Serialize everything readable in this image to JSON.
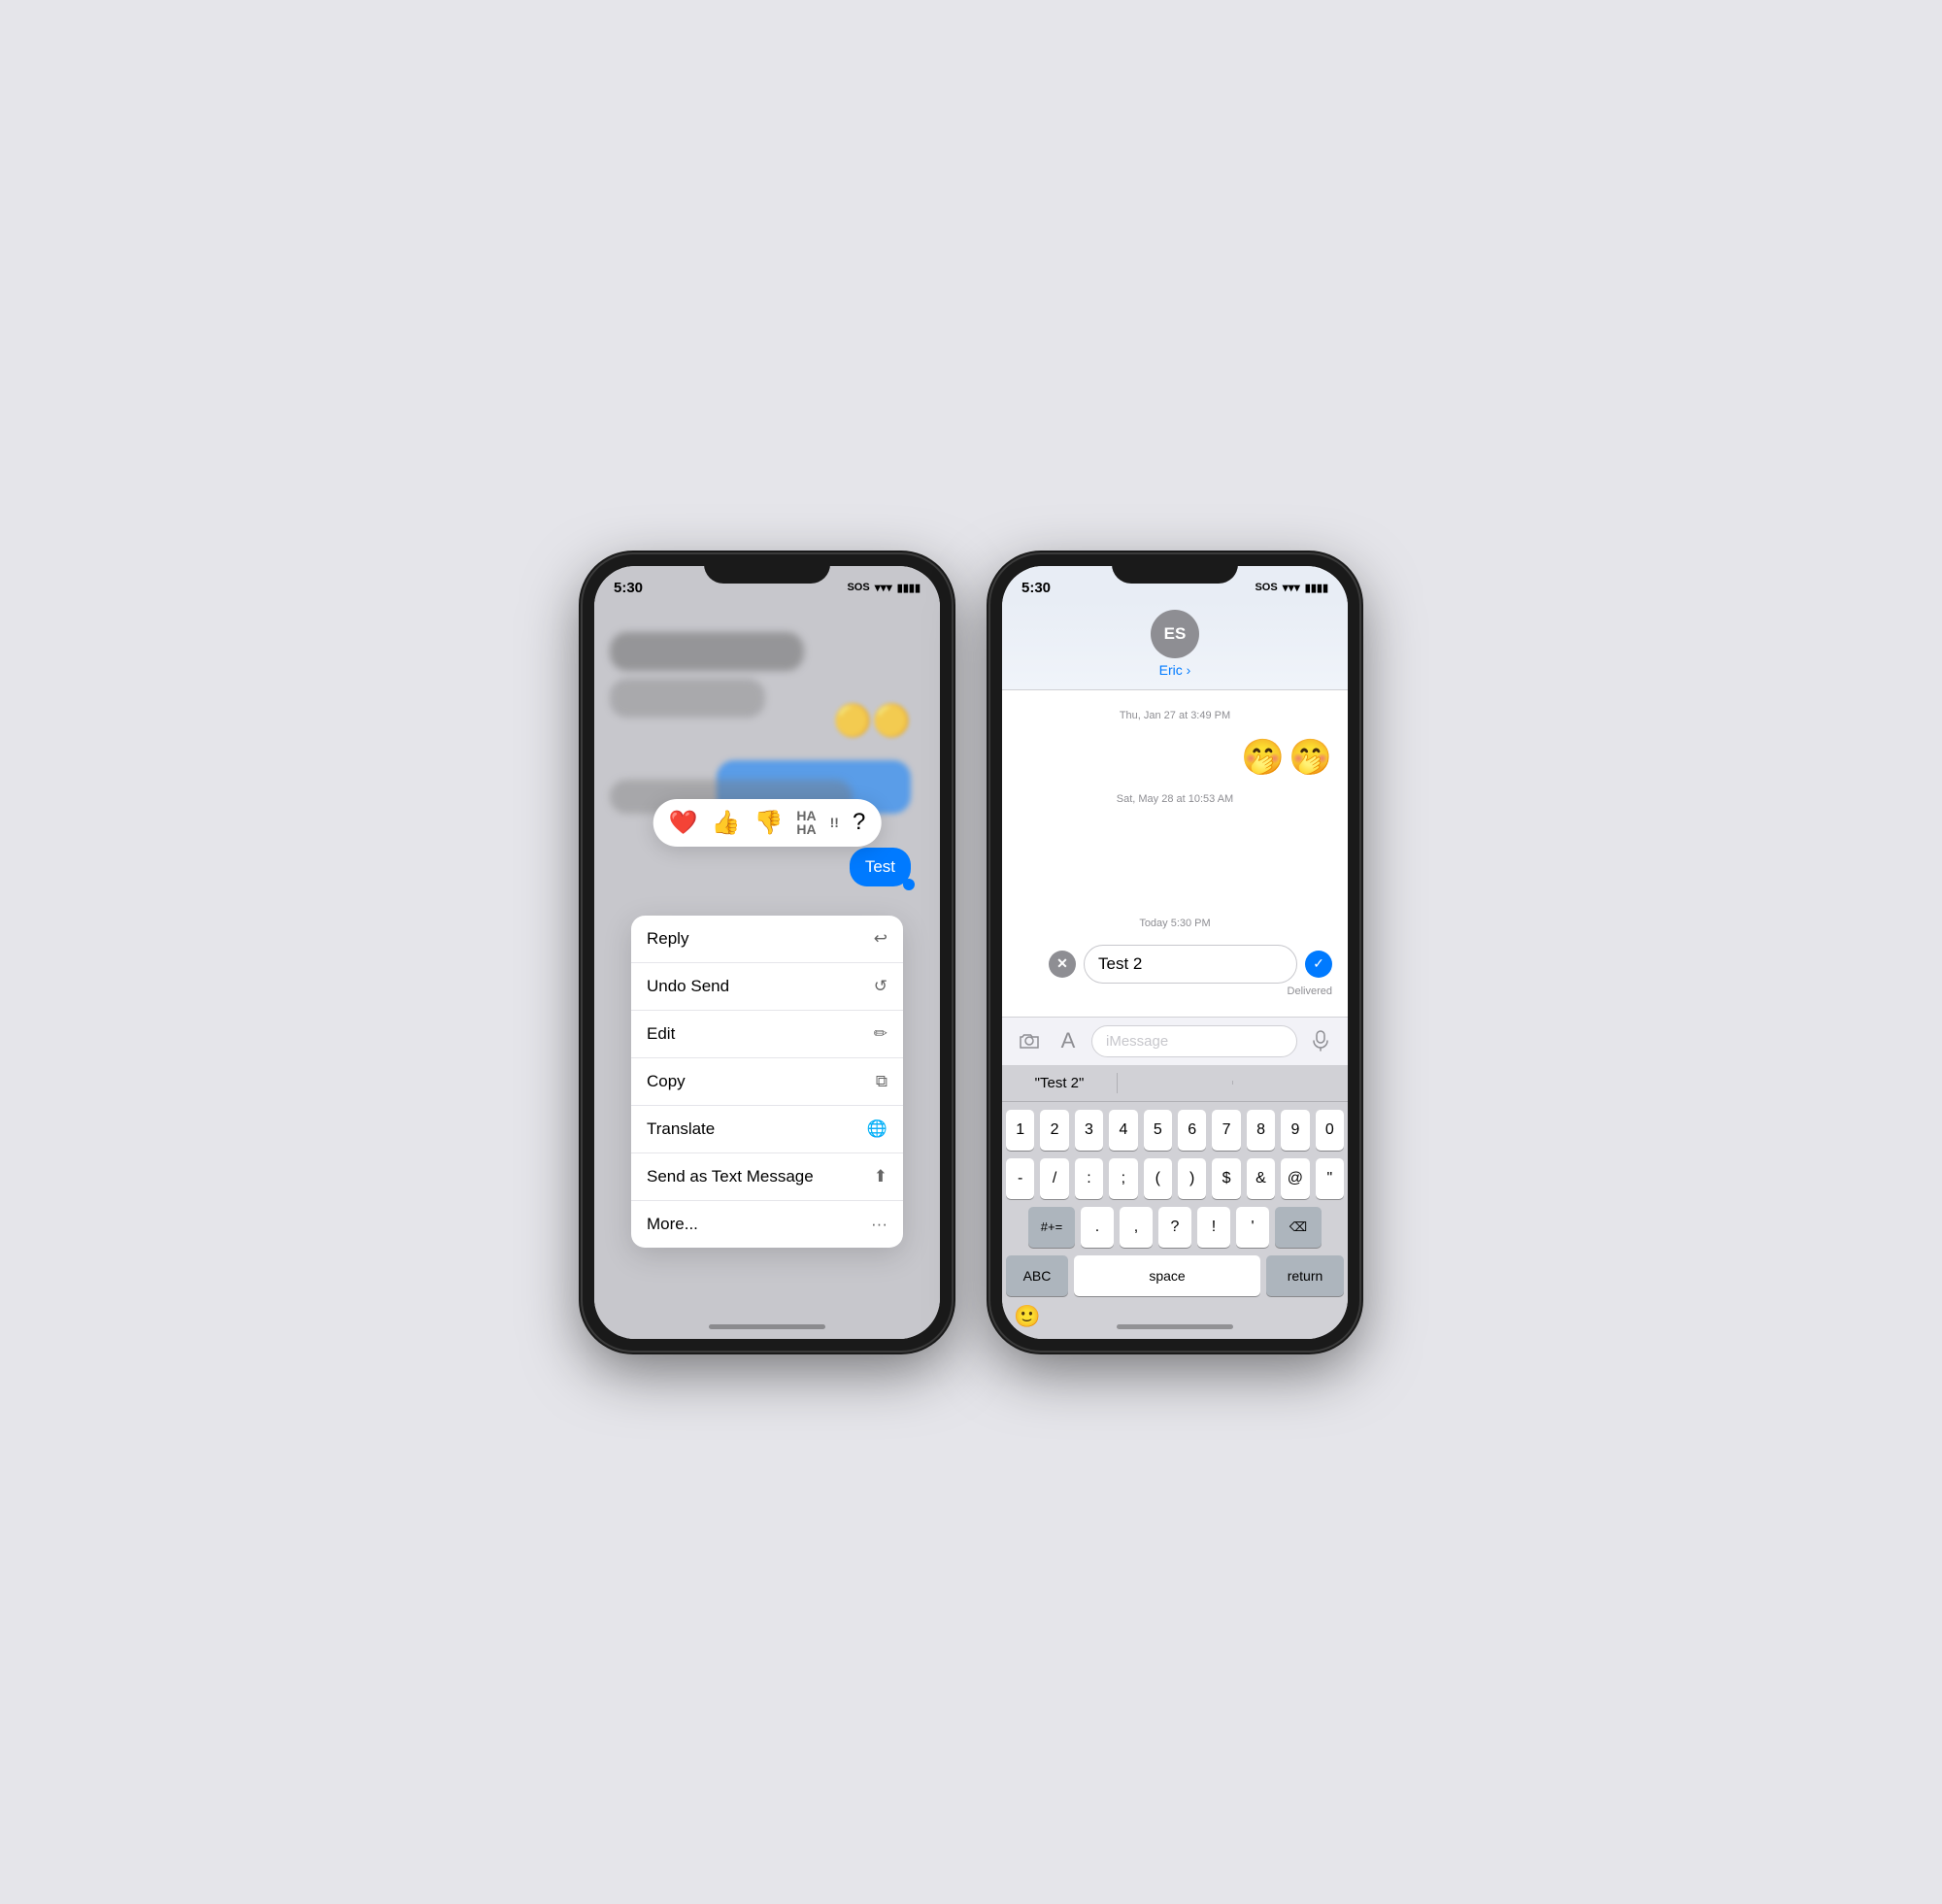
{
  "phones": {
    "left": {
      "status": {
        "time": "5:30",
        "sos": "SOS",
        "wifi": "wifi",
        "battery": "battery"
      },
      "bg_emoji": "🟡🟡",
      "test_bubble": "Test",
      "reactions": [
        "❤️",
        "👍",
        "👎",
        "HA\nHA",
        "!!",
        "?"
      ],
      "menu_items": [
        {
          "label": "Reply",
          "icon": "↩"
        },
        {
          "label": "Undo Send",
          "icon": "↺"
        },
        {
          "label": "Edit",
          "icon": "✏"
        },
        {
          "label": "Copy",
          "icon": "⧉"
        },
        {
          "label": "Translate",
          "icon": "🌐"
        },
        {
          "label": "Send as Text Message",
          "icon": "⬆"
        },
        {
          "label": "More...",
          "icon": "···"
        }
      ]
    },
    "right": {
      "status": {
        "time": "5:30",
        "sos": "SOS",
        "wifi": "wifi",
        "battery": "battery"
      },
      "contact": {
        "initials": "ES",
        "name": "Eric"
      },
      "timestamps": {
        "first": "Thu, Jan 27 at 3:49 PM",
        "second": "Sat, May 28 at 10:53 AM",
        "today": "Today 5:30 PM"
      },
      "emojis": "🤭🤭",
      "edit_bubble": "Test 2",
      "delivered": "Delivered",
      "input_placeholder": "iMessage",
      "predictive": "\"Test 2\"",
      "keyboard": {
        "row1": [
          "1",
          "2",
          "3",
          "4",
          "5",
          "6",
          "7",
          "8",
          "9",
          "0"
        ],
        "row2": [
          "-",
          "/",
          ":",
          ";",
          "(",
          ")",
          "$",
          "&",
          "@",
          "\""
        ],
        "row3_left": [
          "#+="
        ],
        "row3_mid": [
          ".",
          "'",
          ",",
          "?",
          "!",
          "'"
        ],
        "row3_right": [
          "⌫"
        ],
        "bottom_left": "ABC",
        "bottom_mid": "space",
        "bottom_right": "return"
      }
    }
  }
}
